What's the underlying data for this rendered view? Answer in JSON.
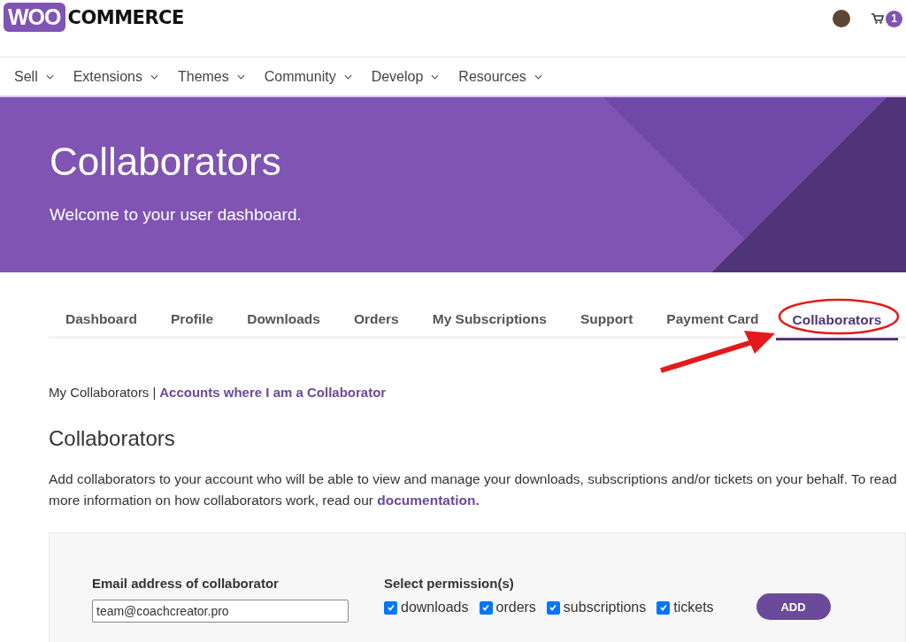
{
  "logo": {
    "mark": "WOO",
    "word": "COMMERCE"
  },
  "cart": {
    "count": "1"
  },
  "nav": [
    {
      "label": "Sell"
    },
    {
      "label": "Extensions"
    },
    {
      "label": "Themes"
    },
    {
      "label": "Community"
    },
    {
      "label": "Develop"
    },
    {
      "label": "Resources"
    }
  ],
  "hero": {
    "title": "Collaborators",
    "subtitle": "Welcome to your user dashboard."
  },
  "tabs": [
    {
      "label": "Dashboard",
      "selected": false
    },
    {
      "label": "Profile",
      "selected": false
    },
    {
      "label": "Downloads",
      "selected": false
    },
    {
      "label": "Orders",
      "selected": false
    },
    {
      "label": "My Subscriptions",
      "selected": false
    },
    {
      "label": "Support",
      "selected": false
    },
    {
      "label": "Payment Card",
      "selected": false
    },
    {
      "label": "Collaborators",
      "selected": true
    }
  ],
  "subnav": {
    "current": "My Collaborators",
    "separator": "|",
    "link": "Accounts where I am a Collaborator"
  },
  "section": {
    "heading": "Collaborators",
    "text": "Add collaborators to your account who will be able to view and manage your downloads, subscriptions and/or tickets on your behalf. To read more information on how collaborators work, read our",
    "link": "documentation."
  },
  "form": {
    "email_label": "Email address of collaborator",
    "email_value": "team@coachcreator.pro",
    "permissions_label": "Select permission(s)",
    "permissions": [
      {
        "label": "downloads",
        "checked": true
      },
      {
        "label": "orders",
        "checked": true
      },
      {
        "label": "subscriptions",
        "checked": true
      },
      {
        "label": "tickets",
        "checked": true
      }
    ],
    "button": "ADD"
  }
}
